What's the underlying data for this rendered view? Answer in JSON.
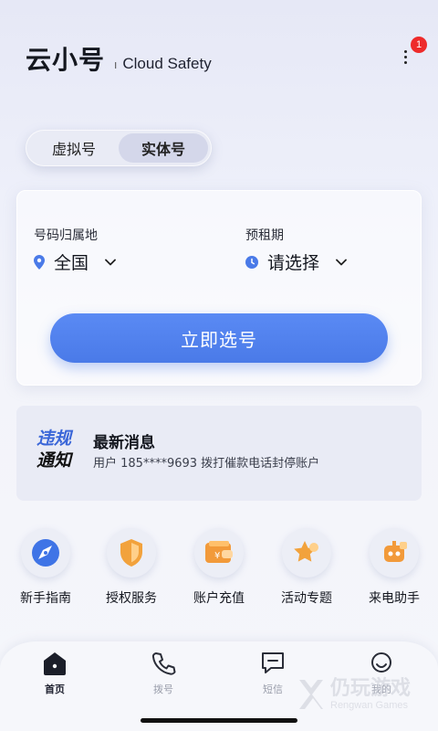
{
  "header": {
    "title": "云小号",
    "subtitle": "Cloud Safety",
    "badge_count": "1"
  },
  "tabs_segment": [
    {
      "label": "虚拟号",
      "active": false
    },
    {
      "label": "实体号",
      "active": true
    }
  ],
  "filter_card": {
    "region_label": "号码归属地",
    "region_value": "全国",
    "period_label": "预租期",
    "period_value": "请选择",
    "submit_label": "立即选号"
  },
  "notice": {
    "tag_line1": "违规",
    "tag_line2": "通知",
    "title": "最新消息",
    "text": "用户 185****9693 拨打催款电话封停账户"
  },
  "services": [
    {
      "label": "新手指南",
      "icon": "compass-icon"
    },
    {
      "label": "授权服务",
      "icon": "shield-icon"
    },
    {
      "label": "账户充值",
      "icon": "wallet-icon"
    },
    {
      "label": "活动专题",
      "icon": "star-icon"
    },
    {
      "label": "来电助手",
      "icon": "robot-icon"
    }
  ],
  "tabbar": [
    {
      "label": "首页",
      "icon": "home-icon",
      "active": true
    },
    {
      "label": "拨号",
      "icon": "phone-icon",
      "active": false
    },
    {
      "label": "短信",
      "icon": "message-icon",
      "active": false
    },
    {
      "label": "我的",
      "icon": "user-icon",
      "active": false
    }
  ],
  "watermark": {
    "cn": "仍玩游戏",
    "en": "Rengwan Games"
  },
  "colors": {
    "primary": "#4a7ae8",
    "badge": "#ee2b2b",
    "notice_tag": "#3a66d8"
  }
}
